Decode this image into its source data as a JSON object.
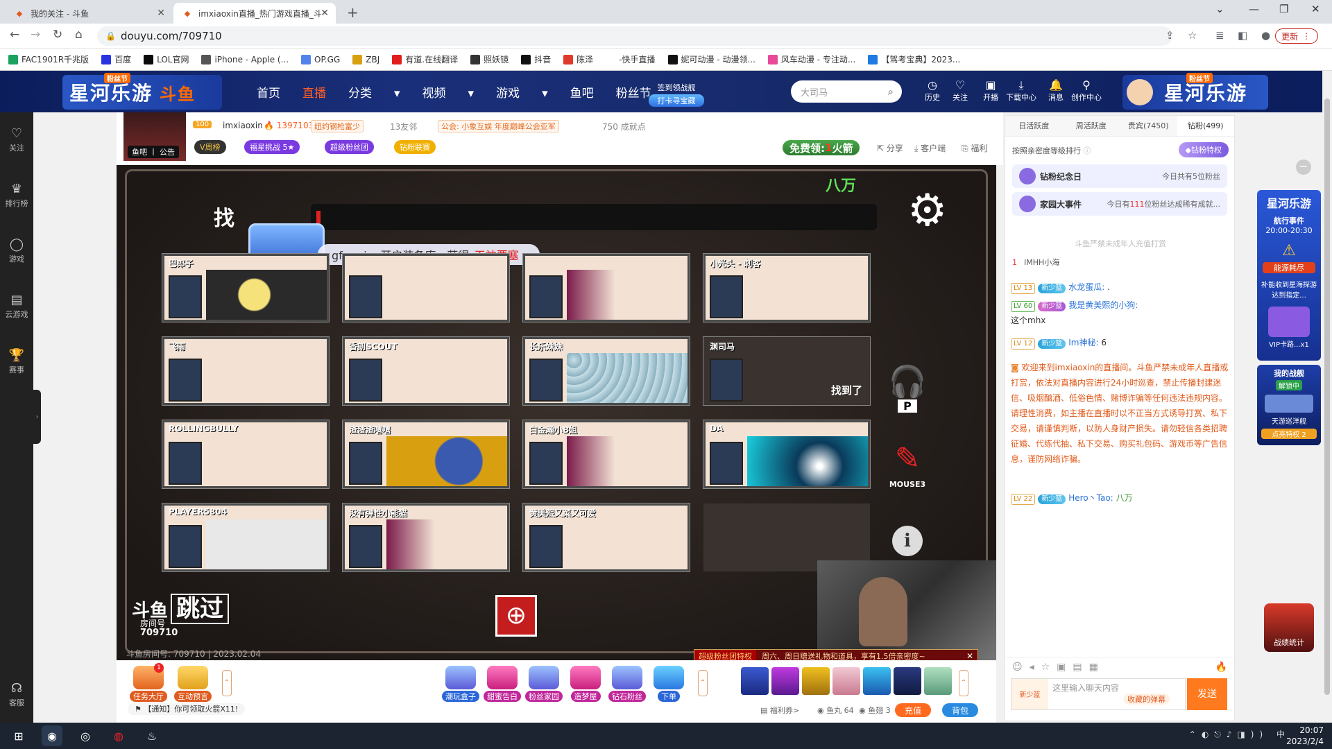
{
  "browser": {
    "tabs": [
      {
        "title": "我的关注 - 斗鱼"
      },
      {
        "title": "imxiaoxin直播_热门游戏直播_斗"
      }
    ],
    "url": "douyu.com/709710",
    "update_label": "更新",
    "bookmarks": [
      {
        "label": "FAC1901R千兆版",
        "color": "#1aa260"
      },
      {
        "label": "百度",
        "color": "#2932e1"
      },
      {
        "label": "LOL官网",
        "color": "#0a0a0a"
      },
      {
        "label": "iPhone - Apple (...",
        "color": "#555555"
      },
      {
        "label": "OP.GG",
        "color": "#5383e8"
      },
      {
        "label": "ZBJ",
        "color": "#d8a010"
      },
      {
        "label": "有道.在线翻译",
        "color": "#e01e1e"
      },
      {
        "label": "照妖镜",
        "color": "#333333"
      },
      {
        "label": "抖音",
        "color": "#111111"
      },
      {
        "label": "陈泽",
        "color": "#e03a2a"
      },
      {
        "label": "-快手直播",
        "color": "#ffffff"
      },
      {
        "label": "妮可动漫 - 动漫领...",
        "color": "#111111"
      },
      {
        "label": "风车动漫 - 专注动...",
        "color": "#e84a9a"
      },
      {
        "label": "【驾考宝典】2023...",
        "color": "#1d7ae0"
      }
    ]
  },
  "header": {
    "logo_text": "星河乐游",
    "logo_tag": "粉丝节",
    "brand": "斗鱼",
    "nav": [
      "首页",
      "直播",
      "分类",
      "视频",
      "游戏",
      "鱼吧",
      "粉丝节"
    ],
    "sign_top": "签到领战舰",
    "sign_bottom": "打卡寻宝藏",
    "search_placeholder": "大司马",
    "icons": [
      {
        "label": "历史",
        "glyph": "◷"
      },
      {
        "label": "关注",
        "glyph": "♡"
      },
      {
        "label": "开播",
        "glyph": "▣"
      },
      {
        "label": "下载中心",
        "glyph": "⤓"
      },
      {
        "label": "消息",
        "glyph": "🔔"
      },
      {
        "label": "创作中心",
        "glyph": "⚲"
      }
    ]
  },
  "left_rail": [
    {
      "label": "关注",
      "glyph": "♡"
    },
    {
      "label": "排行榜",
      "glyph": "♛"
    },
    {
      "label": "游戏",
      "glyph": "◯"
    },
    {
      "label": "云游戏",
      "glyph": "▤"
    },
    {
      "label": "赛事",
      "glyph": "🏆"
    },
    {
      "label": "客服",
      "glyph": "☊"
    }
  ],
  "streamer": {
    "avatar_label": "鱼吧 丨 公告",
    "level": "100",
    "name": "imxiaoxin",
    "heat": "1397103",
    "tag1": "纽约钢枪富少",
    "friends": "13友邻",
    "guild": "公会: 小象互娱",
    "guild_award": "年度巅峰公会亚军",
    "achievements": "750 成就点",
    "pills": [
      "V周榜",
      "福星挑战 5★",
      "超级粉丝团",
      "钻粉联赛"
    ],
    "free_label": "免费领:",
    "free_num": "1",
    "free_item": "火箭",
    "links": [
      "分享",
      "客户端",
      "福利"
    ]
  },
  "game": {
    "money": "八万",
    "title_glyph": "找",
    "notice_user": "gfuggjvg开启装备库，获得:",
    "notice_item": "天神要塞",
    "players": [
      {
        "name": "巴郎子"
      },
      {
        "name": ""
      },
      {
        "name": ""
      },
      {
        "name": "小光头 - 刺客"
      },
      {
        "name": "飞雨"
      },
      {
        "name": "香朗SCOUT"
      },
      {
        "name": "长乐妹妹"
      },
      {
        "name": "渊司马"
      },
      {
        "name": "ROLLINGBULLY"
      },
      {
        "name": "渣渣渣嘻嘻"
      },
      {
        "name": "白金瀚小B姐"
      },
      {
        "name": "DA"
      },
      {
        "name": "PLAYER5804"
      },
      {
        "name": "没有弹性小能猫"
      },
      {
        "name": "黄美熙又菜又可爱"
      }
    ],
    "found_label": "找到了",
    "hotkey_p": "P",
    "hotkey_mouse": "MOUSE3",
    "skip_label": "跳过",
    "room_label": "房间号",
    "room_no": "709710",
    "footer": "斗鱼房间号: 709710 | 2023.02.04",
    "fan_left": "超级粉丝团特权",
    "fan_text": "周六、周日赠送礼物和道具，享有1.5倍亲密度~"
  },
  "tools": {
    "left": [
      {
        "label": "任务大厅",
        "badge": "1"
      },
      {
        "label": "互动预言"
      }
    ],
    "mid": [
      "潮玩盒子",
      "甜蜜告白",
      "粉丝家园",
      "造梦屋",
      "钻石粉丝",
      "下单"
    ],
    "notify": "【通知】你可领取火箭X11!",
    "wallet": [
      "福利券>",
      "鱼丸 64",
      "鱼翅 3"
    ],
    "recharge": "充值",
    "bag": "背包"
  },
  "panel": {
    "tabs": [
      "日活跃度",
      "周活跃度",
      "贵宾(7450)",
      "钻粉(499)"
    ],
    "rank_hint": "按照亲密度等级排行",
    "vip_btn": "钻粉特权",
    "event1": "钻粉纪念日",
    "event1_r": "今日共有5位粉丝",
    "event2": "家园大事件",
    "event2_pre": "今日有",
    "event2_num": "111",
    "event2_post": "位粉丝达成稀有成就...",
    "warn": "斗鱼严禁未成年人充值打赏",
    "top1_rank": "1",
    "top1_name": "IMHH小海",
    "chat": [
      {
        "lv": "LV 13",
        "badge": "新少篮",
        "user": "水龙蛋瓜:",
        "text": "."
      },
      {
        "lv": "LV 60",
        "badge": "新少篮",
        "user": "我是黄美熙的小狗:",
        "text": "这个mhx"
      },
      {
        "lv": "LV 12",
        "badge": "新少篮",
        "user": "Im神秘:",
        "text": "6"
      }
    ],
    "sys_msg": "欢迎来到imxiaoxin的直播间。斗鱼严禁未成年人直播或打赏，依法对直播内容进行24小时巡查，禁止传播封建迷信、吸烟酗酒、低俗色情、赌博诈骗等任何违法违规内容。请理性消费，如主播在直播时以不正当方式诱导打赏、私下交易，请谨慎判断，以防人身财产损失。请勿轻信各类招聘征婚、代练代抽、私下交易、购买礼包码、游戏币等广告信息，谨防网络诈骗。",
    "last_lv": "LV 22",
    "last_badge": "新少篮",
    "last_user": "Hero丶Tao:",
    "last_text": "八万",
    "input_placeholder": "这里输入聊天内容",
    "sticker": "新少篮",
    "barrage": "收藏的弹幕",
    "send": "发送"
  },
  "promo": {
    "title": "星河乐游",
    "event": "航行事件",
    "time": "20:00-20:30",
    "status": "能源耗尽",
    "desc": "补能收到星海探游达到指定...",
    "card": "VIP卡路...x1",
    "battle": "我的战舰",
    "unlock": "解锁中",
    "ship": "天游巡洋舰",
    "privilege": "点亮特权 2",
    "stats": "战绩统计"
  },
  "taskbar": {
    "time": "20:07",
    "date": "2023/2/4",
    "ime": "中"
  }
}
